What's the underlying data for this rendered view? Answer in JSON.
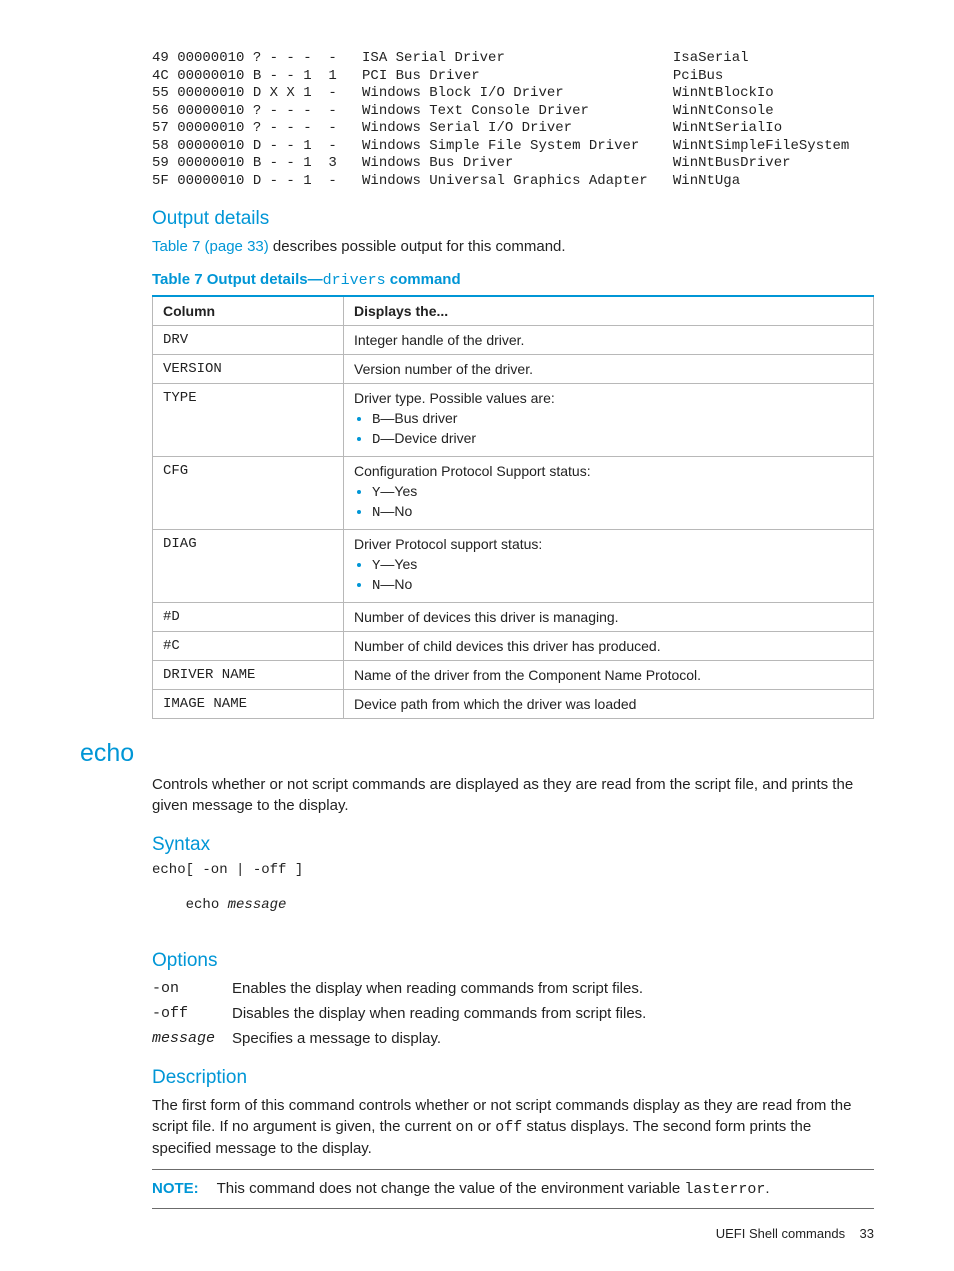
{
  "pre": "49 00000010 ? - - -  -   ISA Serial Driver                    IsaSerial\n4C 00000010 B - - 1  1   PCI Bus Driver                       PciBus\n55 00000010 D X X 1  -   Windows Block I/O Driver             WinNtBlockIo\n56 00000010 ? - - -  -   Windows Text Console Driver          WinNtConsole\n57 00000010 ? - - -  -   Windows Serial I/O Driver            WinNtSerialIo\n58 00000010 D - - 1  -   Windows Simple File System Driver    WinNtSimpleFileSystem\n59 00000010 B - - 1  3   Windows Bus Driver                   WinNtBusDriver\n5F 00000010 D - - 1  -   Windows Universal Graphics Adapter   WinNtUga",
  "sections": {
    "output_details_h": "Output details",
    "output_details_link": "Table 7 (page 33)",
    "output_details_text": " describes possible output for this command.",
    "table_title_prefix": "Table 7 Output details—",
    "table_title_code": "drivers",
    "table_title_suffix": " command"
  },
  "table": {
    "headers": [
      "Column",
      "Displays the..."
    ],
    "rows": [
      {
        "col": "DRV",
        "desc": "Integer handle of the driver."
      },
      {
        "col": "VERSION",
        "desc": "Version number of the driver."
      },
      {
        "col": "TYPE",
        "desc_lead": "Driver type. Possible values are:",
        "bullets": [
          {
            "code": "B",
            "text": "—Bus driver"
          },
          {
            "code": "D",
            "text": "—Device driver"
          }
        ]
      },
      {
        "col": "CFG",
        "desc_lead": "Configuration Protocol Support status:",
        "bullets": [
          {
            "code": "Y",
            "text": "—Yes"
          },
          {
            "code": "N",
            "text": "—No"
          }
        ]
      },
      {
        "col": "DIAG",
        "desc_lead": "Driver Protocol support status:",
        "bullets": [
          {
            "code": "Y",
            "text": "—Yes"
          },
          {
            "code": "N",
            "text": "—No"
          }
        ]
      },
      {
        "col": "#D",
        "desc": "Number of devices this driver is managing."
      },
      {
        "col": "#C",
        "desc": "Number of child devices this driver has produced."
      },
      {
        "col": "DRIVER NAME",
        "desc": "Name of the driver from the Component Name Protocol."
      },
      {
        "col": "IMAGE NAME",
        "desc": "Device path from which the driver was loaded"
      }
    ]
  },
  "echo": {
    "heading": "echo",
    "intro": "Controls whether or not script commands are displayed as they are read from the script file, and prints the given message to the display.",
    "syntax_h": "Syntax",
    "syntax1": "echo[ -on | -off ]",
    "syntax2_code": "echo ",
    "syntax2_arg": "message",
    "options_h": "Options",
    "options": [
      {
        "term": "-on",
        "desc": "Enables the display when reading commands from script files."
      },
      {
        "term": "-off",
        "desc": "Disables the display when reading commands from script files."
      },
      {
        "term_italic": "message",
        "desc": "Specifies a message to display."
      }
    ],
    "description_h": "Description",
    "desc_p1a": "The first form of this command controls whether or not script commands display as they are read from the script file. If no argument is given, the current ",
    "desc_on": "on",
    "desc_p1b": " or ",
    "desc_off": "off",
    "desc_p1c": " status displays. The second form prints the specified message to the display.",
    "note_label": "NOTE:",
    "note_text_a": "This command does not change the value of the environment variable ",
    "note_code": "lasterror",
    "note_text_b": "."
  },
  "footer": {
    "section": "UEFI Shell commands",
    "page": "33"
  }
}
